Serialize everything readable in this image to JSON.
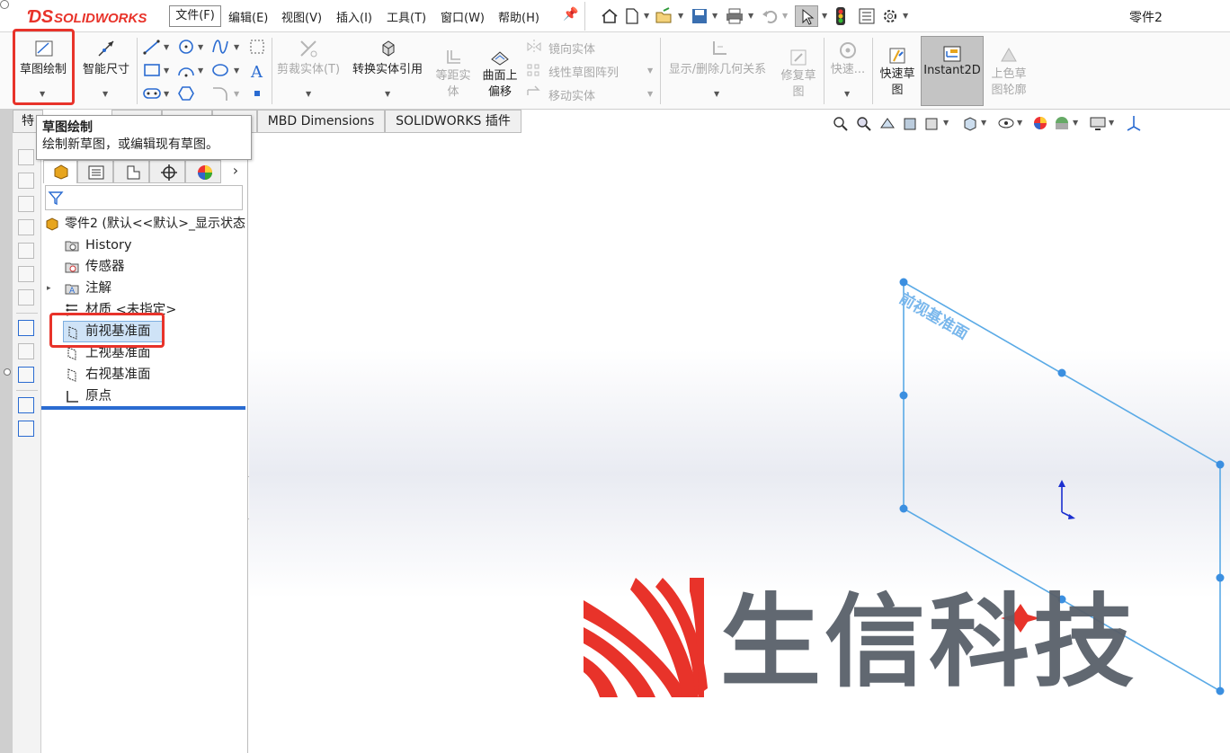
{
  "app": {
    "brand": "SOLIDWORKS",
    "doc_title": "零件2"
  },
  "menu": [
    "文件(F)",
    "编辑(E)",
    "视图(V)",
    "插入(I)",
    "工具(T)",
    "窗口(W)",
    "帮助(H)"
  ],
  "ribbon": {
    "sketch": "草图绘制",
    "smart_dim": "智能尺寸",
    "trim": "剪裁实体(T)",
    "convert": "转换实体引用",
    "offset_1": "等距实",
    "offset_2": "体",
    "surface_1": "曲面上",
    "surface_2": "偏移",
    "mirror": "镜向实体",
    "pattern": "线性草图阵列",
    "move": "移动实体",
    "relations": "显示/删除几何关系",
    "repair_1": "修复草",
    "repair_2": "图",
    "quick": "快速...",
    "quicksketch_1": "快速草",
    "quicksketch_2": "图",
    "instant2d": "Instant2D",
    "shaded_1": "上色草",
    "shaded_2": "图轮廓"
  },
  "tabs": {
    "t1": "特",
    "mbd": "MBD Dimensions",
    "addins": "SOLIDWORKS 插件"
  },
  "tooltip": {
    "title": "草图绘制",
    "desc": "绘制新草图，或编辑现有草图。"
  },
  "tree": {
    "root": "零件2  (默认<<默认>_显示状态",
    "history": "History",
    "sensors": "传感器",
    "annotations": "注解",
    "material": "材质 <未指定>",
    "front": "前视基准面",
    "top": "上视基准面",
    "right": "右视基准面",
    "origin": "原点"
  },
  "viewport": {
    "plane_label": "前视基准面"
  },
  "watermark": {
    "text": "生信科技"
  },
  "colors": {
    "accent": "#e8332a",
    "plane": "#5aaae6",
    "highlight": "#cfe3f7",
    "watermark_red": "#e8332a",
    "watermark_gray": "#59606a"
  }
}
